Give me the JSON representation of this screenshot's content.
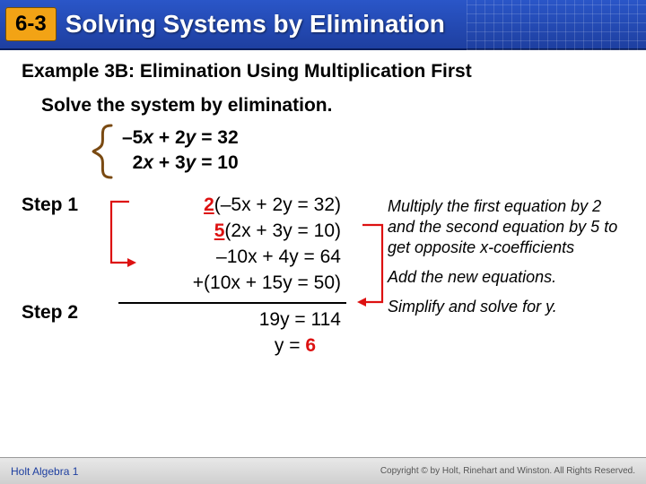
{
  "header": {
    "lesson": "6-3",
    "title": "Solving Systems by Elimination"
  },
  "example_heading": "Example 3B: Elimination Using Multiplication First",
  "instruction": "Solve the system by elimination.",
  "system": {
    "eq1_lhs_a": "–5",
    "eq1_lhs_b": " + 2",
    "eq1_rhs": " = 32",
    "eq2_lhs_a": "2",
    "eq2_lhs_b": " + 3",
    "eq2_rhs": " = 10"
  },
  "steps": {
    "step1_label": "Step 1",
    "step2_label": "Step 2",
    "step1": {
      "l1_pre": "2",
      "l1_body": "(–5x + 2y = 32)",
      "l2_pre": "5",
      "l2_body": "(2x + 3y  = 10)",
      "l3": "–10x + 4y = 64",
      "l4": "+(10x + 15y = 50)"
    },
    "step2": {
      "l1": "19y = 114",
      "l2_lhs": "y = ",
      "l2_rhs": "6"
    }
  },
  "explanations": {
    "e1": "Multiply the first equation by 2 and the second equation by 5 to get opposite x-coefficients",
    "e2": "Add the new equations.",
    "e3": "Simplify and solve for y."
  },
  "footer": {
    "left": "Holt Algebra 1",
    "right": "Copyright © by Holt, Rinehart and Winston. All Rights Reserved."
  }
}
